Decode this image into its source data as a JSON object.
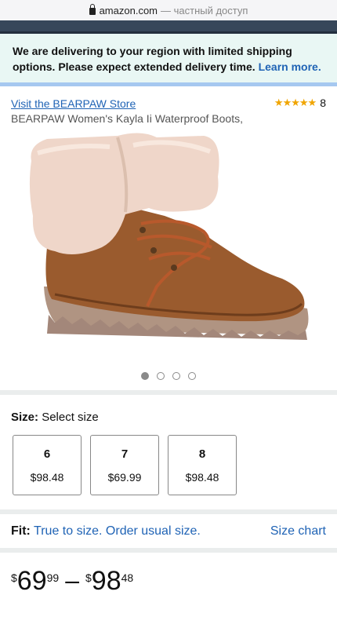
{
  "browser": {
    "domain": "amazon.com",
    "mode_label": "— частный доступ"
  },
  "banner": {
    "message": "We are delivering to your region with limited shipping options. Please expect extended delivery time.",
    "link_text": "Learn more."
  },
  "product": {
    "store_link": "Visit the BEARPAW Store",
    "rating_stars": "★★★★★",
    "rating_count": "8",
    "title": "BEARPAW Women's Kayla Ii Waterproof Boots,",
    "image_icon": "boot-image",
    "image_count": 4,
    "active_image": 1
  },
  "size": {
    "label": "Size:",
    "value": "Select size",
    "options": [
      {
        "size": "6",
        "price": "$98.48"
      },
      {
        "size": "7",
        "price": "$69.99"
      },
      {
        "size": "8",
        "price": "$98.48"
      }
    ]
  },
  "fit": {
    "label": "Fit:",
    "text": "True to size. Order usual size.",
    "size_chart": "Size chart"
  },
  "price_range": {
    "low": {
      "currency": "$",
      "whole": "69",
      "fraction": "99"
    },
    "separator": "–",
    "high": {
      "currency": "$",
      "whole": "98",
      "fraction": "48"
    }
  },
  "colors": {
    "link": "#1f63b5",
    "star": "#f0a500",
    "banner_bg": "#e9f7f4"
  }
}
